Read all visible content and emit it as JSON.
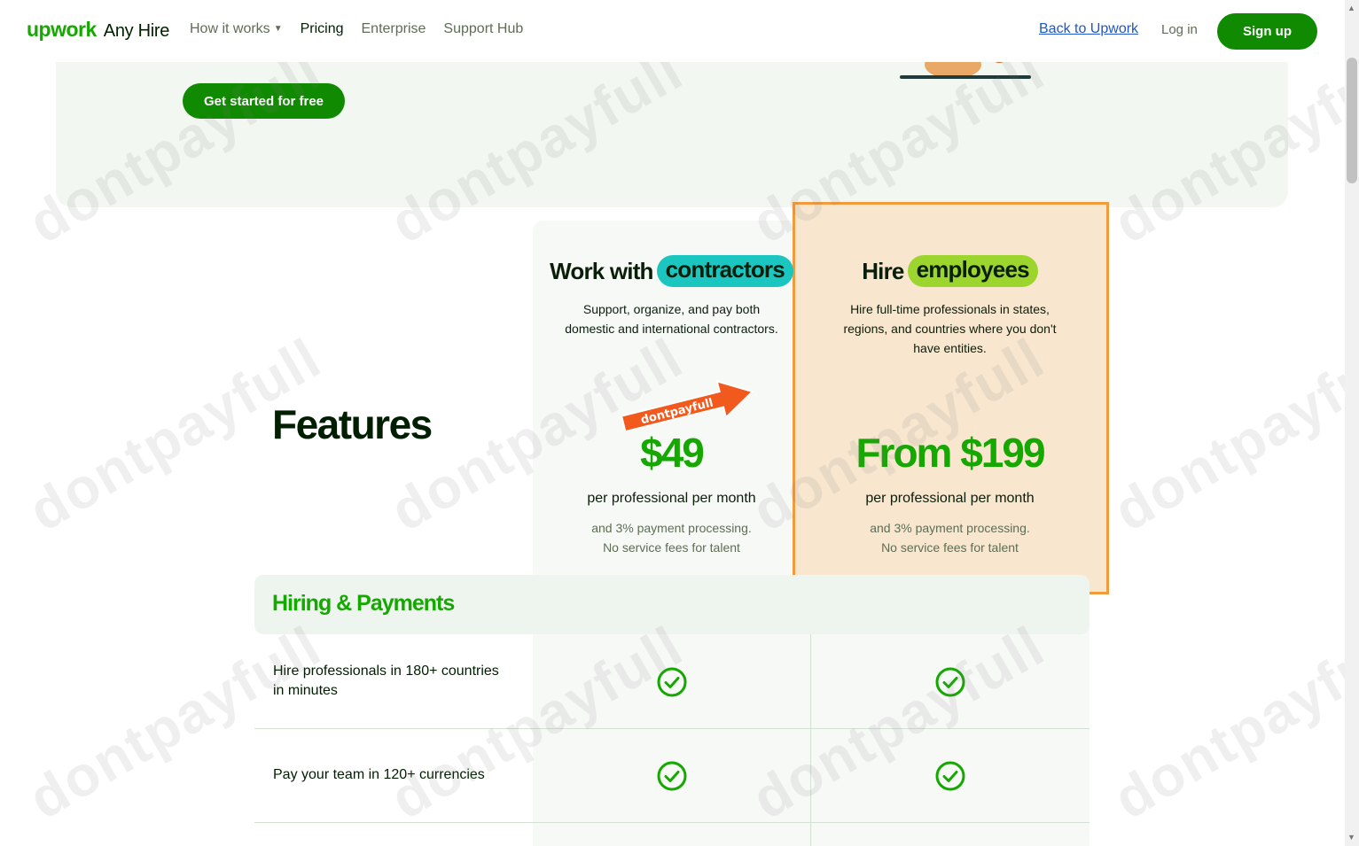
{
  "header": {
    "logo_brand": "upwork",
    "logo_product": "Any Hire",
    "nav": {
      "how_it_works": "How it works",
      "pricing": "Pricing",
      "enterprise": "Enterprise",
      "support_hub": "Support Hub"
    },
    "back_link": "Back to Upwork",
    "login": "Log in",
    "signup": "Sign up"
  },
  "hero": {
    "cta": "Get started for free"
  },
  "plans": {
    "contractors": {
      "title_prefix": "Work with",
      "title_highlight": "contractors",
      "desc_line1": "Support, organize, and pay both",
      "desc_line2": "domestic and international contractors.",
      "price": "$49",
      "per": "per professional per month",
      "fine_line1": "and 3% payment processing.",
      "fine_line2": "No service fees for talent"
    },
    "employees": {
      "title_prefix": "Hire",
      "title_highlight": "employees",
      "desc_line1": "Hire full-time professionals in states,",
      "desc_line2": "regions, and countries where you don't",
      "desc_line3": "have entities.",
      "price": "From $199",
      "per": "per professional per month",
      "fine_line1": "and 3% payment processing.",
      "fine_line2": "No service fees for talent"
    }
  },
  "features_title": "Features",
  "section": {
    "title": "Hiring & Payments",
    "rows": [
      {
        "label_line1": "Hire professionals in 180+ countries",
        "label_line2": "in minutes",
        "contractors": true,
        "employees": true
      },
      {
        "label_line1": "Pay your team in 120+ currencies",
        "label_line2": "",
        "contractors": true,
        "employees": true
      }
    ]
  },
  "promo_badge": "dontpayfull",
  "watermark": "dontpayfull",
  "colors": {
    "brand_green": "#14a800",
    "button_green": "#108a00",
    "teal_pill": "#1bc5c0",
    "lime_pill": "#9dd52f",
    "highlight_border": "#f29a3c",
    "highlight_fill": "#f8e6cf"
  }
}
